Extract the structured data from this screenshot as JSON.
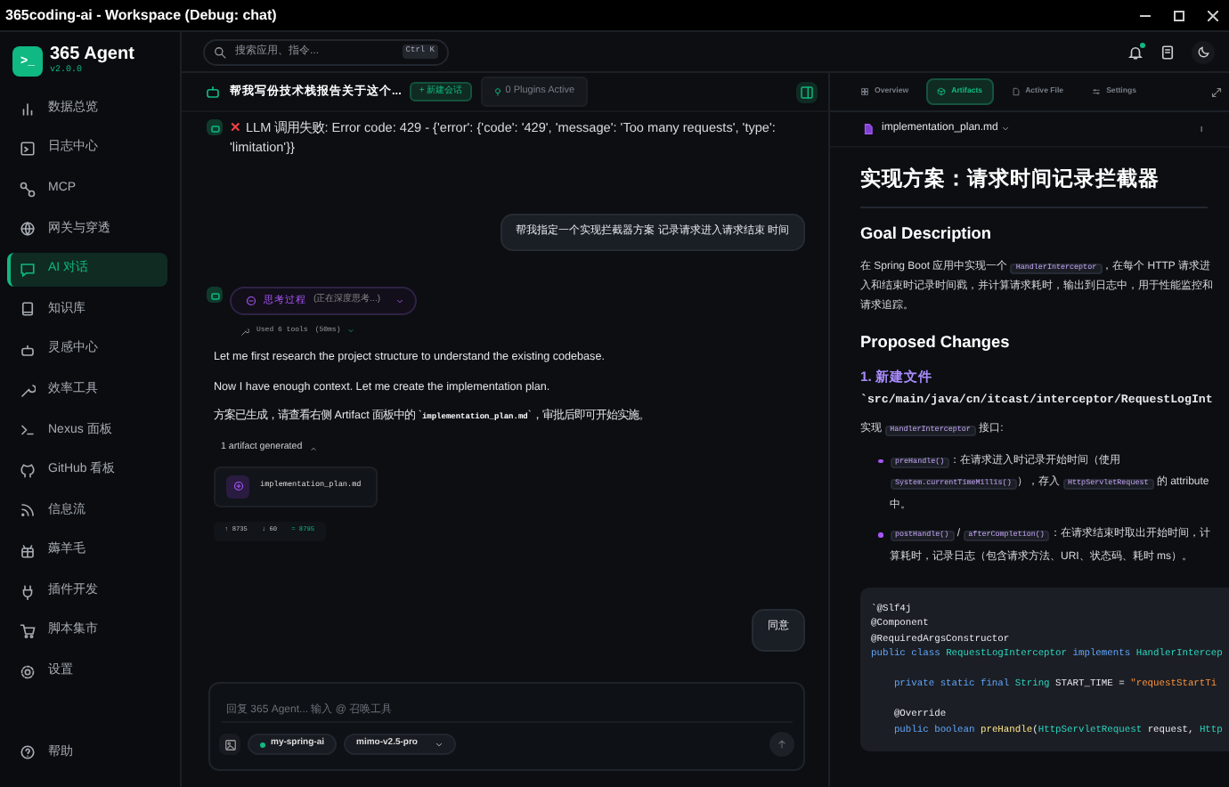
{
  "window": {
    "title": "365coding-ai - Workspace (Debug: chat)"
  },
  "brand": {
    "name": "365 Agent",
    "version": "v2.0.0",
    "logo": ">_"
  },
  "sidebar": {
    "items": [
      {
        "label": "数据总览",
        "selected": false
      },
      {
        "label": "日志中心",
        "selected": false
      },
      {
        "label": "MCP",
        "selected": false
      },
      {
        "label": "网关与穿透",
        "selected": false
      },
      {
        "label": "AI 对话",
        "selected": true
      },
      {
        "label": "知识库",
        "selected": false
      },
      {
        "label": "灵感中心",
        "selected": false
      },
      {
        "label": "效率工具",
        "selected": false
      },
      {
        "label": "Nexus 面板",
        "selected": false
      },
      {
        "label": "GitHub 看板",
        "selected": false
      },
      {
        "label": "信息流",
        "selected": false
      },
      {
        "label": "薅羊毛",
        "selected": false
      },
      {
        "label": "插件开发",
        "selected": false
      },
      {
        "label": "脚本集市",
        "selected": false
      },
      {
        "label": "设置",
        "selected": false
      }
    ],
    "footer": "帮助"
  },
  "search": {
    "placeholder": "搜索应用、指令...",
    "shortcut": "Ctrl K"
  },
  "notifications": {
    "unread": true
  },
  "chat": {
    "title": "帮我写份技术栈报告关于这个...",
    "new_button": "+ 新建会话",
    "plugins": "0 Plugins Active",
    "messages": [
      {
        "kind": "error",
        "mark": "✕",
        "text": "LLM 调用失败: Error code: 429 - {'error': {'code': '429', 'message': 'Too many requests', 'type': 'limitation'}}"
      },
      {
        "kind": "user",
        "text": "帮我指定一个实现拦截器方案 记录请求进入请求结束 时间"
      },
      {
        "kind": "assistant",
        "thinking": {
          "label": "思考过程",
          "status": "(正在深度思考...)",
          "expanded": false
        },
        "tools": {
          "label": "Used 6 tools",
          "time": "(50ms)"
        },
        "paragraphs": [
          [
            {
              "kind": "text",
              "text": "Let me first research the project structure to understand the existing codebase."
            }
          ],
          [
            {
              "kind": "text",
              "text": "Now I have enough context. Let me create the implementation plan."
            }
          ],
          [
            {
              "kind": "text",
              "text": "方案已生成，请查看右侧 Artifact 面板中的 `"
            },
            {
              "kind": "code",
              "text": "implementation_plan.md"
            },
            {
              "kind": "text",
              "text": "`，审批后即可开始实施。"
            }
          ]
        ],
        "artifacts": {
          "label": "1 artifact generated",
          "expanded": true,
          "files": [
            "implementation_plan.md"
          ]
        },
        "tokens": [
          {
            "kind": "up",
            "text": "↑ 8735"
          },
          {
            "kind": "down",
            "text": "↓ 60"
          },
          {
            "kind": "total",
            "text": "= 8795"
          }
        ]
      },
      {
        "kind": "user",
        "text": "同意"
      }
    ],
    "input": {
      "placeholder": "回复 365 Agent... 输入 @ 召唤工具",
      "project": "my-spring-ai",
      "model": "mimo-v2.5-pro"
    }
  },
  "panel": {
    "tabs": [
      {
        "label": "Overview",
        "selected": false
      },
      {
        "label": "Artifacts",
        "selected": true
      },
      {
        "label": "Active File",
        "selected": false
      },
      {
        "label": "Settings",
        "selected": false
      }
    ],
    "file": "implementation_plan.md",
    "document": [
      {
        "kind": "h1",
        "parts": [
          {
            "kind": "text",
            "text": "实现方案：请求时间记录拦截器"
          }
        ]
      },
      {
        "kind": "h2",
        "parts": [
          {
            "kind": "text",
            "text": "Goal Description"
          }
        ]
      },
      {
        "kind": "p",
        "parts": [
          {
            "kind": "text",
            "text": "在 Spring Boot 应用中实现一个 "
          },
          {
            "kind": "code",
            "text": "HandlerInterceptor"
          },
          {
            "kind": "text",
            "text": "，在每个 HTTP 请求进入和结束时记录时间戳，并计算请求耗时，输出到日志中，用于性能监控和请求追踪。"
          }
        ]
      },
      {
        "kind": "h2",
        "parts": [
          {
            "kind": "text",
            "text": "Proposed Changes"
          }
        ]
      },
      {
        "kind": "h3",
        "parts": [
          {
            "kind": "text",
            "text": "1. 新建文件"
          }
        ]
      },
      {
        "kind": "path",
        "parts": [
          {
            "kind": "text",
            "text": "`src/main/java/cn/itcast/interceptor/RequestLogInt"
          }
        ]
      },
      {
        "kind": "p",
        "parts": [
          {
            "kind": "text",
            "text": "实现 "
          },
          {
            "kind": "code",
            "text": "HandlerInterceptor"
          },
          {
            "kind": "text",
            "text": " 接口:"
          }
        ]
      },
      {
        "kind": "li",
        "parts": [
          {
            "kind": "code",
            "text": "preHandle()"
          },
          {
            "kind": "text",
            "text": "：在请求进入时记录开始时间（使用 "
          },
          {
            "kind": "code",
            "text": "System.currentTimeMillis()"
          },
          {
            "kind": "text",
            "text": "），存入 "
          },
          {
            "kind": "code",
            "text": "HttpServletRequest"
          },
          {
            "kind": "text",
            "text": " 的 attribute 中。"
          }
        ]
      },
      {
        "kind": "li",
        "parts": [
          {
            "kind": "code",
            "text": "postHandle()"
          },
          {
            "kind": "text",
            "text": " / "
          },
          {
            "kind": "code",
            "text": "afterCompletion()"
          },
          {
            "kind": "text",
            "text": "：在请求结束时取出开始时间，计算耗时，记录日志（包含请求方法、URI、状态码、耗时 ms）。"
          }
        ]
      },
      {
        "kind": "code",
        "lines": [
          {
            "spaced": false,
            "segments": [
              {
                "kind": "plain",
                "text": "`@Slf4j"
              }
            ]
          },
          {
            "spaced": false,
            "segments": [
              {
                "kind": "plain",
                "text": "@Component"
              }
            ]
          },
          {
            "spaced": false,
            "segments": [
              {
                "kind": "plain",
                "text": "@RequiredArgsConstructor"
              }
            ]
          },
          {
            "spaced": false,
            "segments": [
              {
                "kind": "kw",
                "text": "public class "
              },
              {
                "kind": "type",
                "text": "RequestLogInterceptor "
              },
              {
                "kind": "kw",
                "text": "implements "
              },
              {
                "kind": "type",
                "text": "HandlerIntercep"
              }
            ]
          },
          {
            "spaced": true,
            "segments": [
              {
                "kind": "kw",
                "text": "    private static final "
              },
              {
                "kind": "type",
                "text": "String "
              },
              {
                "kind": "plain",
                "text": "START_TIME = "
              },
              {
                "kind": "str",
                "text": "\"requestStartTi"
              }
            ]
          },
          {
            "spaced": true,
            "segments": [
              {
                "kind": "plain",
                "text": "    @Override"
              }
            ]
          },
          {
            "spaced": false,
            "segments": [
              {
                "kind": "kw",
                "text": "    public boolean "
              },
              {
                "kind": "fn",
                "text": "preHandle"
              },
              {
                "kind": "plain",
                "text": "("
              },
              {
                "kind": "type",
                "text": "HttpServletRequest "
              },
              {
                "kind": "plain",
                "text": "request, "
              },
              {
                "kind": "type",
                "text": "Http"
              }
            ]
          }
        ]
      }
    ]
  }
}
